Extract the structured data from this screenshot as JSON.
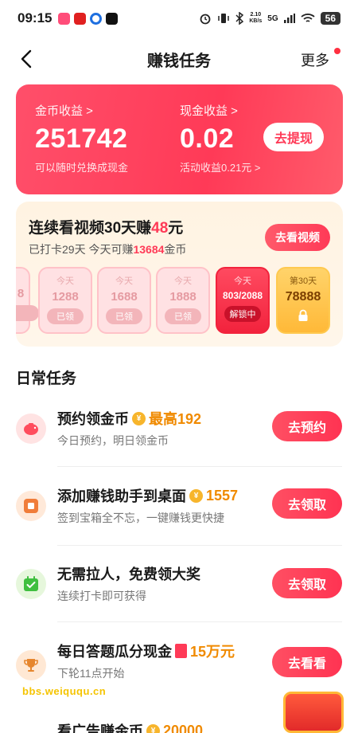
{
  "status_bar": {
    "time": "09:15",
    "network_speed": "2.10\nKB/s",
    "signal": "5G",
    "battery": "56"
  },
  "nav": {
    "title": "赚钱任务",
    "more": "更多"
  },
  "earnings": {
    "coins_label": "金币收益 >",
    "coins_value": "251742",
    "coins_sub": "可以随时兑换成现金",
    "cash_label": "现金收益 >",
    "cash_value": "0.02",
    "cash_sub": "活动收益0.21元 >",
    "withdraw": "去提现"
  },
  "video_task": {
    "title_prefix": "连续看视频30天赚",
    "title_amount": "48",
    "title_suffix": "元",
    "sub_prefix": "已打卡29天 今天可赚",
    "sub_amount": "13684",
    "sub_suffix": "金币",
    "button": "去看视频",
    "days": [
      {
        "label": "今天",
        "value": "1288",
        "badge": "已领"
      },
      {
        "label": "今天",
        "value": "1688",
        "badge": "已领"
      },
      {
        "label": "今天",
        "value": "1888",
        "badge": "已领"
      },
      {
        "label": "今天",
        "value": "803/2088",
        "badge": "解锁中"
      },
      {
        "label": "第30天",
        "value": "78888"
      }
    ]
  },
  "daily": {
    "title": "日常任务",
    "tasks": [
      {
        "title": "预约领金币",
        "reward": "最高192",
        "sub": "今日预约，明日领金币",
        "button": "去预约",
        "icon": "piggy-bank-icon"
      },
      {
        "title": "添加赚钱助手到桌面",
        "reward": "1557",
        "sub": "签到宝箱全不忘，一键赚钱更快捷",
        "button": "去领取",
        "icon": "widget-icon"
      },
      {
        "title": "无需拉人，免费领大奖",
        "reward": "",
        "sub": "连续打卡即可获得",
        "button": "去领取",
        "icon": "calendar-check-icon"
      },
      {
        "title": "每日答题瓜分现金",
        "reward": "15万元",
        "sub": "下轮11点开始",
        "button": "去看看",
        "icon": "trophy-icon"
      },
      {
        "title": "看广告赚金币",
        "reward": "20000",
        "sub": "",
        "button": "",
        "icon": "ad-icon"
      }
    ]
  },
  "watermark": "bbs.weiququ.cn"
}
